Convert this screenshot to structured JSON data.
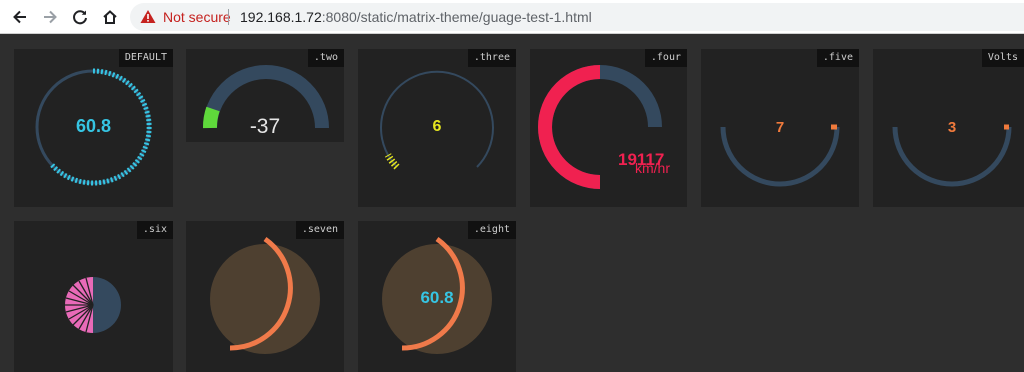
{
  "browser": {
    "security_label": "Not secure",
    "url_host": "192.168.1.72",
    "url_rest": ":8080/static/matrix-theme/guage-test-1.html"
  },
  "gauges": [
    {
      "label": "DEFAULT",
      "value": "60.8",
      "value_color": "#36c5e3",
      "accent": "#36c5e3"
    },
    {
      "label": ".two",
      "value": "-37",
      "value_color": "#e6e6e6",
      "accent": "#5fd93b"
    },
    {
      "label": ".three",
      "value": "6",
      "value_color": "#e6e61f",
      "accent": "#e6e61f"
    },
    {
      "label": ".four",
      "value": "19117",
      "unit": "km/hr",
      "value_color": "#f02150",
      "accent": "#f02150"
    },
    {
      "label": ".five",
      "value": "7",
      "value_color": "#f07a3c",
      "accent": "#f07a3c"
    },
    {
      "label": "Volts",
      "value": "3",
      "value_color": "#f07a3c",
      "accent": "#f07a3c"
    },
    {
      "label": ".six",
      "accent": "#e86ab8"
    },
    {
      "label": ".seven",
      "accent": "#f07a4a"
    },
    {
      "label": ".eight",
      "value": "60.8",
      "value_color": "#36c5e3",
      "accent": "#f07a4a"
    }
  ],
  "theme": {
    "track": "#34495e",
    "face": "#4e4030"
  }
}
